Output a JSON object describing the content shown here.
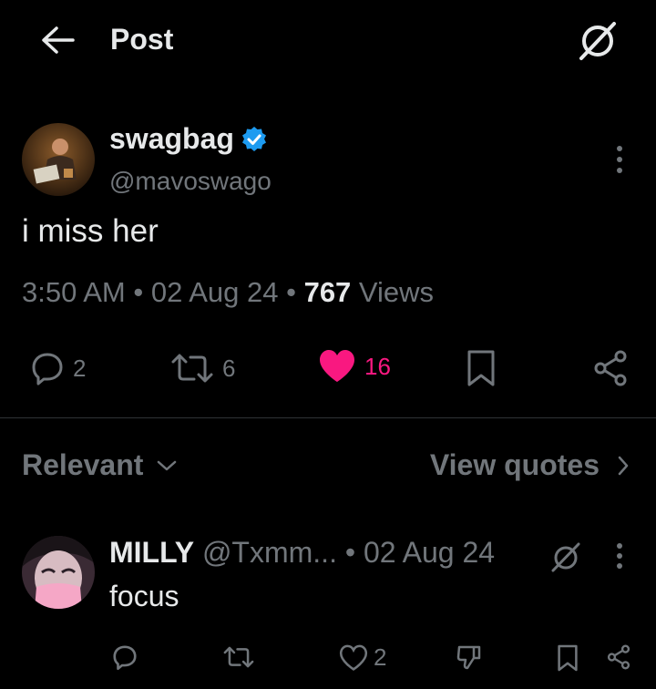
{
  "header": {
    "title": "Post"
  },
  "post": {
    "display_name": "swagbag",
    "handle": "@mavoswago",
    "text": "i miss her",
    "time": "3:50 AM",
    "sep1": " • ",
    "date": "02 Aug 24",
    "sep2": " • ",
    "views_count": "767",
    "views_label": " Views",
    "replies": "2",
    "reposts": "6",
    "likes": "16",
    "verified_color": "#1d9bf0",
    "like_color": "#f91880"
  },
  "sort": {
    "label": "Relevant",
    "quotes_label": "View quotes"
  },
  "reply": {
    "display_name": "MILLY",
    "handle": "@Txmm...",
    "sep": " • ",
    "date": "02 Aug 24",
    "text": "focus",
    "likes": "2"
  }
}
